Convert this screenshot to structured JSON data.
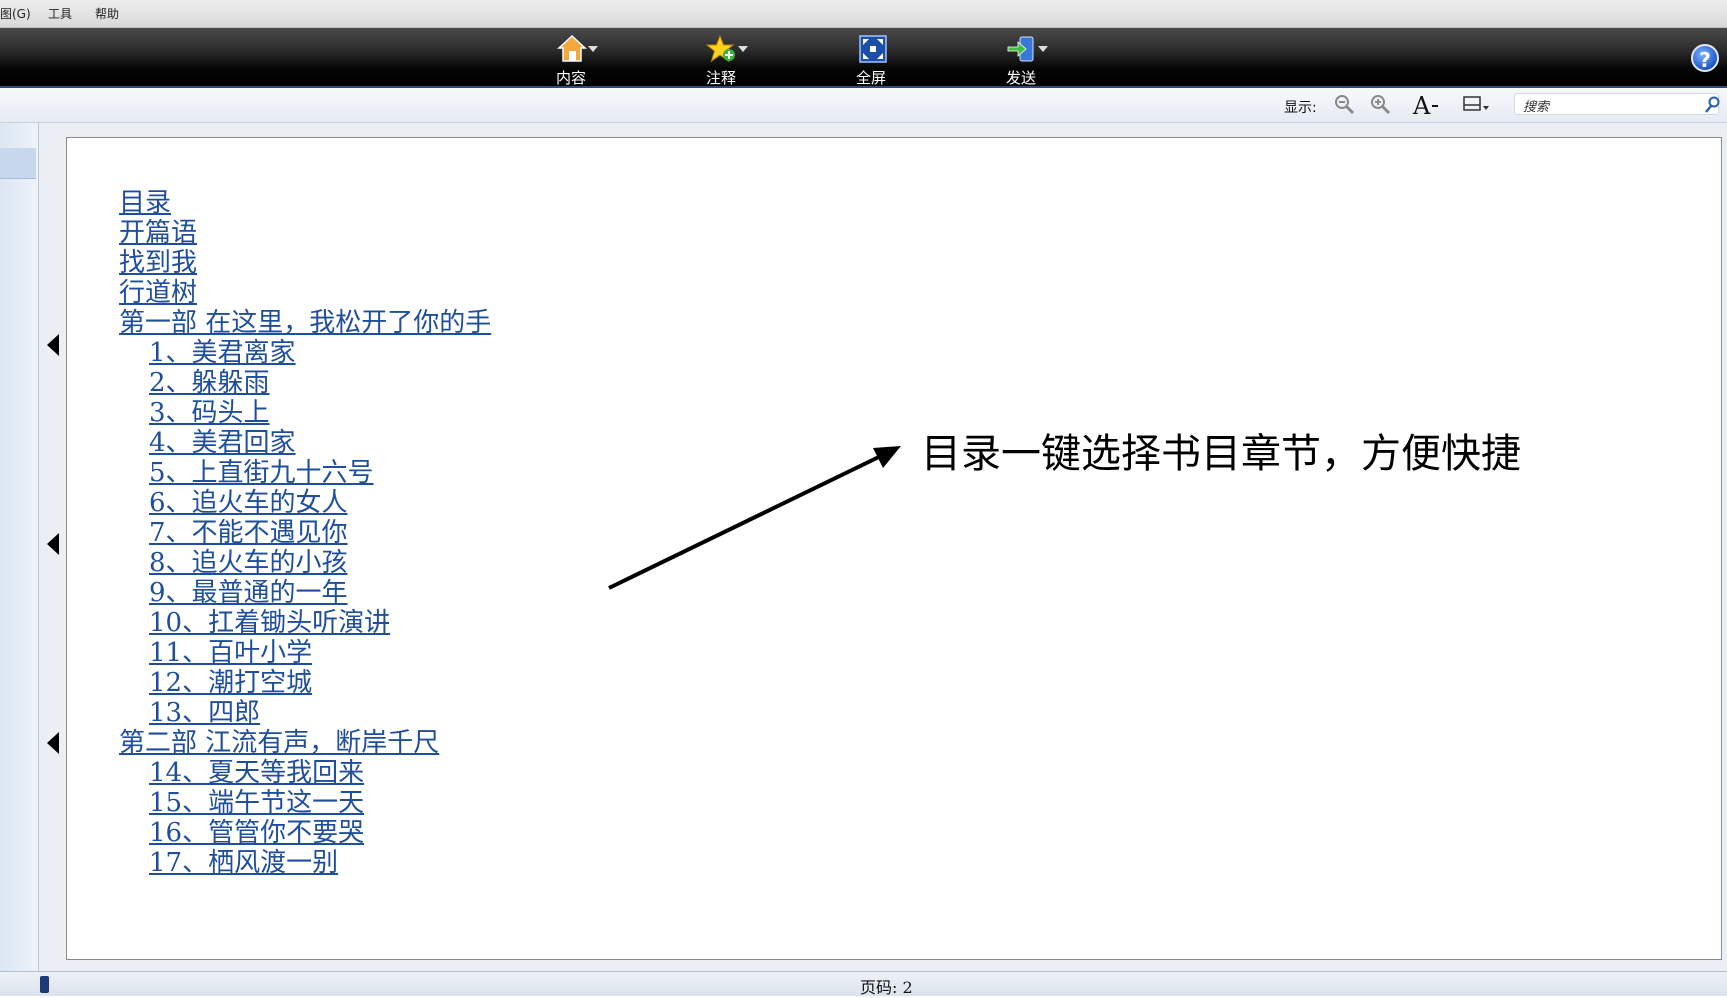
{
  "menu": {
    "items": [
      "图(G)",
      "工具",
      "帮助"
    ]
  },
  "toolbar": {
    "buttons": [
      {
        "label": "内容",
        "icon": "home-icon"
      },
      {
        "label": "注释",
        "icon": "star-icon"
      },
      {
        "label": "全屏",
        "icon": "fullscreen-icon"
      },
      {
        "label": "发送",
        "icon": "send-icon"
      }
    ],
    "help_label": "?"
  },
  "viewbar": {
    "display_label": "显示:",
    "search_placeholder": "搜索"
  },
  "toc": {
    "items": [
      {
        "text": "目录",
        "level": 0
      },
      {
        "text": "开篇语",
        "level": 0
      },
      {
        "text": "找到我",
        "level": 0
      },
      {
        "text": "行道树",
        "level": 0
      },
      {
        "text": "第一部 在这里，我松开了你的手",
        "level": 0
      },
      {
        "text": "1、美君离家",
        "level": 1
      },
      {
        "text": "2、躲躲雨",
        "level": 1
      },
      {
        "text": "3、码头上",
        "level": 1
      },
      {
        "text": "4、美君回家",
        "level": 1
      },
      {
        "text": "5、上直街九十六号",
        "level": 1
      },
      {
        "text": "6、追火车的女人",
        "level": 1
      },
      {
        "text": "7、不能不遇见你",
        "level": 1
      },
      {
        "text": "8、追火车的小孩",
        "level": 1
      },
      {
        "text": "9、最普通的一年",
        "level": 1
      },
      {
        "text": "10、扛着锄头听演讲",
        "level": 1
      },
      {
        "text": "11、百叶小学",
        "level": 1
      },
      {
        "text": "12、潮打空城",
        "level": 1
      },
      {
        "text": "13、四郎",
        "level": 1
      },
      {
        "text": "第二部 江流有声，断岸千尺",
        "level": 0
      },
      {
        "text": "14、夏天等我回来",
        "level": 1
      },
      {
        "text": "15、端午节这一天",
        "level": 1
      },
      {
        "text": "16、管管你不要哭",
        "level": 1
      },
      {
        "text": "17、栖风渡一别",
        "level": 1
      }
    ]
  },
  "annotation": {
    "text": "目录一键选择书目章节，方便快捷"
  },
  "status": {
    "page_label": "页码: 2"
  }
}
